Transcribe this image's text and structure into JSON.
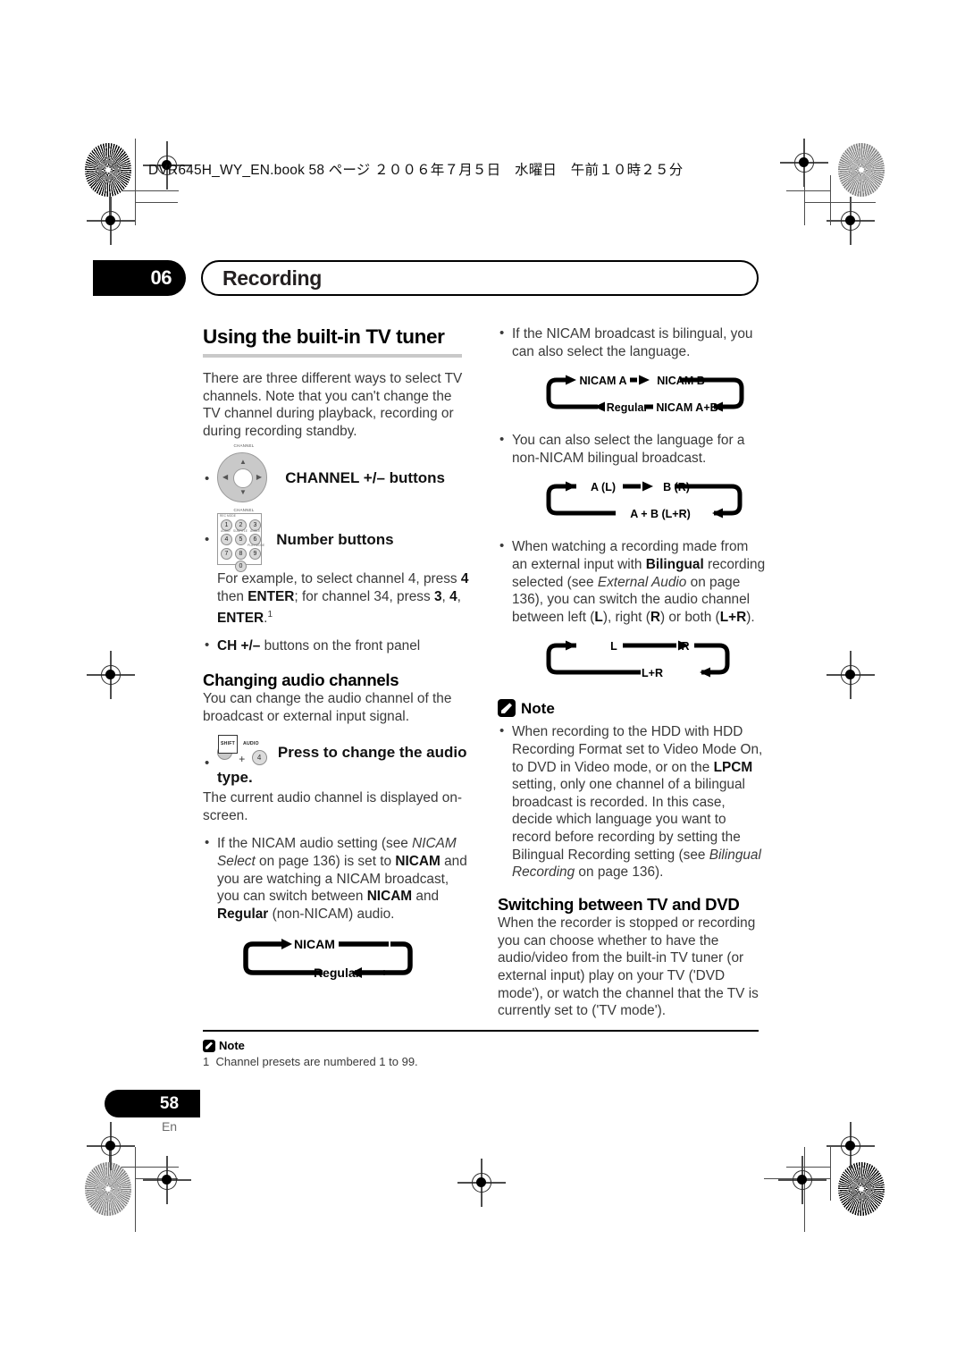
{
  "running_head": "DVR645H_WY_EN.book 58 ページ ２００６年７月５日　水曜日　午前１０時２５分",
  "chapter": {
    "number": "06",
    "title": "Recording"
  },
  "left_column": {
    "heading": "Using the built-in TV tuner",
    "intro": "There are three different ways to select TV channels. Note that you can't change the TV channel during playback, recording or during recording standby.",
    "channel_buttons_label": "CHANNEL +/– buttons",
    "channel_pad": {
      "top_label": "CHANNEL",
      "bottom_label": "CHANNEL",
      "up": "+",
      "down": "+"
    },
    "number_buttons_label": "Number buttons",
    "keypad": {
      "top_label": "REC MODE",
      "keys": [
        "1",
        "2",
        "3",
        "4",
        "5",
        "6",
        "7",
        "8",
        "9",
        "0"
      ],
      "sub_labels": [
        "AUDIO",
        "SUBTITLE",
        "ANGLE",
        "PLAY MODE"
      ]
    },
    "example_text_1": "For example, to select channel 4, press ",
    "example_b_4": "4",
    "example_text_2": " then ",
    "example_b_enter": "ENTER",
    "example_text_3": "; for channel 34, press ",
    "example_b_3": "3",
    "example_text_4": ", ",
    "example_b_4b": "4",
    "example_text_5": ", ",
    "example_b_enter2": "ENTER",
    "example_text_6": ".",
    "example_footnote_ref": "1",
    "front_panel_bold": "CH +/–",
    "front_panel_rest": " buttons on the front panel",
    "audio_heading": "Changing audio channels",
    "audio_intro": "You can change the audio channel of the broadcast or external input signal.",
    "shift_label": "SHIFT",
    "audio_label": "AUDIO",
    "audio_key": "4",
    "press_bold": "Press to change the audio type.",
    "press_after": "The current audio channel is displayed on-screen.",
    "nicam_bullet": {
      "t1": "If the NICAM audio setting (see ",
      "i1": "NICAM Select",
      "t2": " on page 136) is set to ",
      "b1": "NICAM",
      "t3": " and you are watching a NICAM broadcast, you can switch between ",
      "b2": "NICAM",
      "t4": " and ",
      "b3": "Regular",
      "t5": " (non-NICAM) audio."
    },
    "cycle_nicam": {
      "top": "NICAM",
      "bottom": "Regular"
    }
  },
  "right_column": {
    "bullet_bilingual": "If the NICAM broadcast is bilingual, you can also select the language.",
    "cycle_nicam_ab": {
      "top_left": "NICAM A",
      "top_right": "NICAM B",
      "bottom_left": "Regular",
      "bottom_right": "NICAM A+B"
    },
    "bullet_non_nicam": "You can also select the language for a non-NICAM bilingual broadcast.",
    "cycle_ab": {
      "top_left": "A (L)",
      "top_right": "B (R)",
      "bottom": "A + B (L+R)"
    },
    "bullet_external": {
      "t1": "When watching a recording made from an external input with ",
      "b1": "Bilingual",
      "t2": " recording selected (see ",
      "i1": "External Audio",
      "t3": " on page 136), you can switch the audio channel between left (",
      "b2": "L",
      "t4": "), right (",
      "b3": "R",
      "t5": ") or both (",
      "b4": "L+R",
      "t6": ")."
    },
    "cycle_lr": {
      "top_left": "L",
      "top_right": "R",
      "bottom": "L+R"
    },
    "note_label": "Note",
    "note_bullet": {
      "t1": "When recording to the HDD with HDD Recording Format set to Video Mode On, to DVD in Video mode, or on the ",
      "b1": "LPCM",
      "t2": " setting, only one channel of a bilingual broadcast is recorded. In this case, decide which language you want to record before recording by setting the Bilingual Recording setting (see ",
      "i1": "Bilingual Recording",
      "t3": " on page 136)."
    },
    "switch_heading": "Switching between TV and DVD",
    "switch_body": "When the recorder is stopped or recording you can choose whether to have the audio/video from the built-in TV tuner (or external input) play on your TV ('DVD mode'), or watch the channel that the TV is currently set to ('TV mode')."
  },
  "footer": {
    "note_label": "Note",
    "footnote_number": "1",
    "footnote_text": "Channel presets are numbered 1 to 99.",
    "page_number": "58",
    "language_code": "En"
  },
  "colors": {
    "text": "#3a3a3a",
    "heading": "#000000",
    "rule": "#c9c9c9",
    "mark": "#4d4d4d"
  }
}
